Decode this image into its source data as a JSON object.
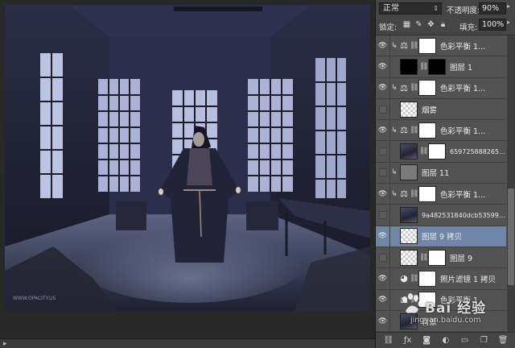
{
  "canvas": {
    "watermark_text": "WWW.OPACITY.US",
    "scroll_indicator": "▸"
  },
  "panel": {
    "blend_mode": "正常",
    "opacity_label": "不透明度:",
    "opacity_value": "90%",
    "lock_label": "锁定:",
    "fill_label": "填充:",
    "fill_value": "100%",
    "layers": [
      {
        "name": "色彩平衡 1...",
        "type": "adjustment",
        "visible": true,
        "clipped": true,
        "thumb": "white",
        "selected": false
      },
      {
        "name": "图层 1",
        "type": "pixel-mask",
        "visible": true,
        "clipped": false,
        "thumb": "black",
        "selected": false
      },
      {
        "name": "色彩平衡 1...",
        "type": "adjustment",
        "visible": true,
        "clipped": true,
        "thumb": "white",
        "selected": false
      },
      {
        "name": "烟雾",
        "type": "pixel",
        "visible": false,
        "clipped": false,
        "thumb": "checker",
        "selected": false
      },
      {
        "name": "色彩平衡 1...",
        "type": "adjustment",
        "visible": true,
        "clipped": true,
        "thumb": "white",
        "selected": false
      },
      {
        "name": "659725888265...",
        "type": "pixel-mask",
        "visible": false,
        "clipped": false,
        "thumb": "photo",
        "selected": false
      },
      {
        "name": "图层 11",
        "type": "pixel",
        "visible": false,
        "clipped": true,
        "thumb": "gray",
        "selected": false
      },
      {
        "name": "色彩平衡 1...",
        "type": "adjustment",
        "visible": true,
        "clipped": true,
        "thumb": "white",
        "selected": false
      },
      {
        "name": "9a482531840dcb535990...",
        "type": "pixel",
        "visible": false,
        "clipped": false,
        "thumb": "photo",
        "selected": false
      },
      {
        "name": "图层 9 拷贝",
        "type": "pixel",
        "visible": true,
        "clipped": false,
        "thumb": "checker",
        "selected": true
      },
      {
        "name": "图层 9",
        "type": "pixel-mask",
        "visible": false,
        "clipped": false,
        "thumb": "checker",
        "selected": false
      },
      {
        "name": "照片滤镜 1 拷贝",
        "type": "adjustment-photo",
        "visible": true,
        "clipped": false,
        "thumb": "white",
        "selected": false
      },
      {
        "name": "色彩平衡 1",
        "type": "adjustment",
        "visible": true,
        "clipped": false,
        "thumb": "white",
        "selected": false
      },
      {
        "name": "背景",
        "type": "background",
        "visible": true,
        "clipped": false,
        "thumb": "photo",
        "selected": false
      }
    ]
  },
  "watermark": {
    "main": "Bai 经验",
    "sub": "jingyan.baidu.com"
  },
  "colors": {
    "panel_bg": "#535353",
    "selected_layer": "#6f86a8",
    "canvas_bg": "#282828"
  }
}
